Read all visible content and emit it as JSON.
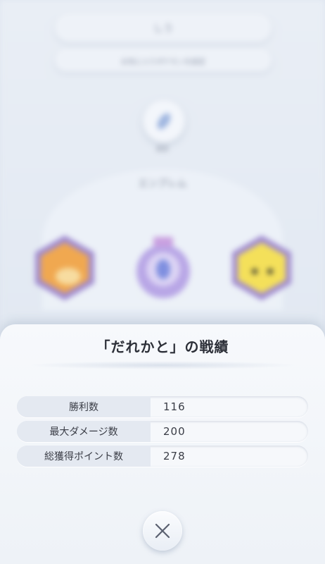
{
  "background": {
    "name_field": "しう",
    "favorite_field": "お気に入りポケモンを設定",
    "icon_label": "設定",
    "emblem_heading": "エンブレム"
  },
  "sheet": {
    "title": "「だれかと」の戦績",
    "stats": [
      {
        "label": "勝利数",
        "value": "116"
      },
      {
        "label": "最大ダメージ数",
        "value": "200"
      },
      {
        "label": "総獲得ポイント数",
        "value": "278"
      }
    ],
    "close_icon": "close-icon"
  },
  "colors": {
    "sheet_bg": "#f7f9fc",
    "label_bg": "#e4e9f1",
    "text": "#2c2f38"
  }
}
